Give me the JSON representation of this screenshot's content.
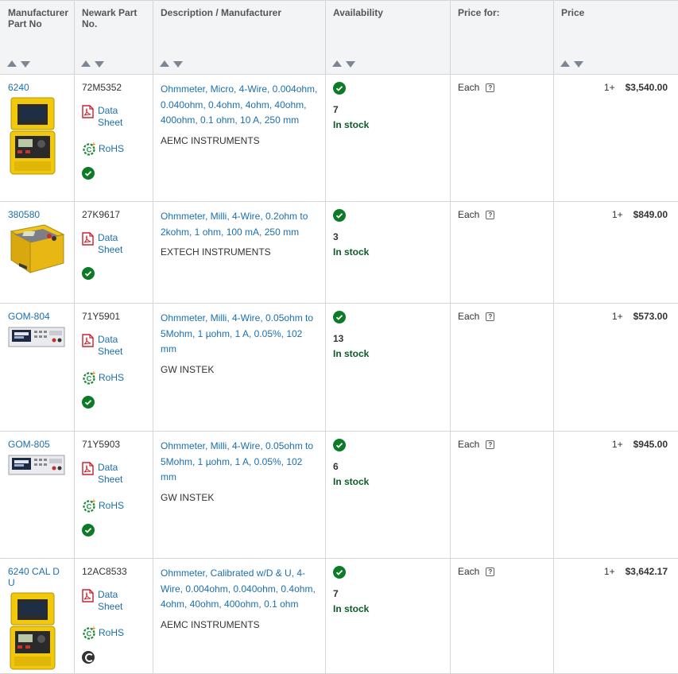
{
  "headers": {
    "mfr_part": "Manufacturer Part No",
    "newark_part": "Newark Part No.",
    "description": "Description / Manufacturer",
    "availability": "Availability",
    "price_for": "Price for:",
    "price": "Price"
  },
  "labels": {
    "data_sheet_1": "Data",
    "data_sheet_2": "Sheet",
    "rohs": "RoHS",
    "in_stock": "In stock"
  },
  "rows": [
    {
      "mfr_part": "6240",
      "newark_part": "72M5352",
      "description": "Ohmmeter, Micro, 4-Wire, 0.004ohm, 0.040ohm, 0.4ohm, 4ohm, 40ohm, 400ohm, 0.1 ohm, 10 A, 250 mm",
      "manufacturer": "AEMC INSTRUMENTS",
      "stock": "7",
      "price_for": "Each",
      "qty": "1+",
      "price": "$3,540.00",
      "rohs": true,
      "status_icon": "check-icon"
    },
    {
      "mfr_part": "380580",
      "newark_part": "27K9617",
      "description": "Ohmmeter, Milli, 4-Wire, 0.2ohm to 2kohm, 1 ohm, 100 mA, 250 mm",
      "manufacturer": "EXTECH INSTRUMENTS",
      "stock": "3",
      "price_for": "Each",
      "qty": "1+",
      "price": "$849.00",
      "rohs": false,
      "status_icon": "check-icon"
    },
    {
      "mfr_part": "GOM-804",
      "newark_part": "71Y5901",
      "description": "Ohmmeter, Milli, 4-Wire, 0.05ohm to 5Mohm, 1 µohm, 1 A, 0.05%, 102 mm",
      "manufacturer": "GW INSTEK",
      "stock": "13",
      "price_for": "Each",
      "qty": "1+",
      "price": "$573.00",
      "rohs": true,
      "status_icon": "check-icon"
    },
    {
      "mfr_part": "GOM-805",
      "newark_part": "71Y5903",
      "description": "Ohmmeter, Milli, 4-Wire, 0.05ohm to 5Mohm, 1 µohm, 1 A, 0.05%, 102 mm",
      "manufacturer": "GW INSTEK",
      "stock": "6",
      "price_for": "Each",
      "qty": "1+",
      "price": "$945.00",
      "rohs": true,
      "status_icon": "check-icon"
    },
    {
      "mfr_part": "6240 CAL D U",
      "newark_part": "12AC8533",
      "description": "Ohmmeter, Calibrated w/D & U, 4-Wire, 0.004ohm, 0.040ohm, 0.4ohm, 4ohm, 40ohm, 400ohm, 0.1 ohm",
      "manufacturer": "AEMC INSTRUMENTS",
      "stock": "7",
      "price_for": "Each",
      "qty": "1+",
      "price": "$3,642.17",
      "rohs": true,
      "status_icon": "pending-icon"
    }
  ],
  "colors": {
    "link": "#1c6fae",
    "in_stock": "#0d5a2a",
    "check": "#0d7a28",
    "header_bg": "#f3f4f6"
  }
}
